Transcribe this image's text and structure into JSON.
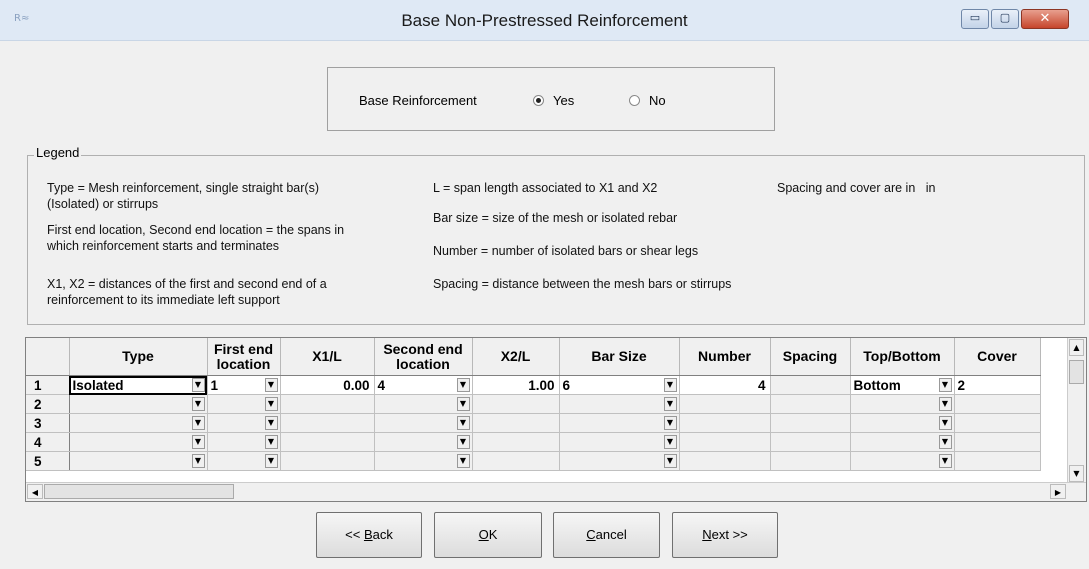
{
  "window": {
    "title": "Base Non-Prestressed Reinforcement",
    "icon_text": "R≈",
    "controls": {
      "minimize": "▭",
      "maximize": "▢",
      "close": "✕"
    }
  },
  "base": {
    "label": "Base Reinforcement",
    "options": [
      {
        "label": "Yes",
        "selected": true
      },
      {
        "label": "No",
        "selected": false
      }
    ]
  },
  "legend": {
    "title": "Legend",
    "col1": [
      "Type = Mesh reinforcement, single straight bar(s)",
      "(Isolated) or stirrups",
      "First end location, Second end location = the spans in",
      "which reinforcement starts and terminates",
      "X1, X2 = distances of the first and second end of a",
      "reinforcement to its immediate left support"
    ],
    "col2": [
      "L = span length associated to X1 and X2",
      "Bar size = size of the mesh or isolated rebar",
      "Number = number of isolated bars or shear legs",
      "Spacing = distance between the mesh bars or stirrups"
    ],
    "col3": "Spacing and cover are in   in"
  },
  "grid": {
    "headers": [
      "Type",
      "First end location",
      "X1/L",
      "Second end location",
      "X2/L",
      "Bar Size",
      "Number",
      "Spacing",
      "Top/Bottom",
      "Cover"
    ],
    "rows": [
      {
        "n": "1",
        "type": "Isolated",
        "first": "1",
        "x1": "0.00",
        "second": "4",
        "x2": "1.00",
        "bar": "6",
        "number": "4",
        "spacing": "",
        "topbottom": "Bottom",
        "cover": "2"
      },
      {
        "n": "2",
        "type": "",
        "first": "",
        "x1": "",
        "second": "",
        "x2": "",
        "bar": "",
        "number": "",
        "spacing": "",
        "topbottom": "",
        "cover": ""
      },
      {
        "n": "3",
        "type": "",
        "first": "",
        "x1": "",
        "second": "",
        "x2": "",
        "bar": "",
        "number": "",
        "spacing": "",
        "topbottom": "",
        "cover": ""
      },
      {
        "n": "4",
        "type": "",
        "first": "",
        "x1": "",
        "second": "",
        "x2": "",
        "bar": "",
        "number": "",
        "spacing": "",
        "topbottom": "",
        "cover": ""
      },
      {
        "n": "5",
        "type": "",
        "first": "",
        "x1": "",
        "second": "",
        "x2": "",
        "bar": "",
        "number": "",
        "spacing": "",
        "topbottom": "",
        "cover": ""
      }
    ]
  },
  "buttons": {
    "back_prefix": "<< ",
    "back_key": "B",
    "back_rest": "ack",
    "ok_key": "O",
    "ok_rest": "K",
    "cancel_key": "C",
    "cancel_rest": "ancel",
    "next_key": "N",
    "next_rest": "ext >>"
  }
}
